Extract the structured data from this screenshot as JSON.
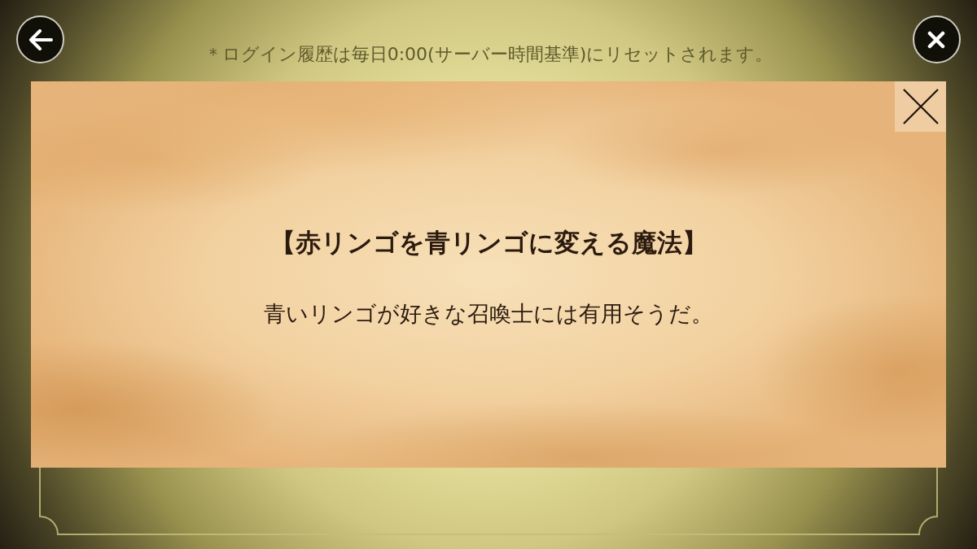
{
  "notice": "＊ログイン履歴は毎日0:00(サーバー時間基準)にリセットされます。",
  "dialog": {
    "title": "【赤リンゴを青リンゴに変える魔法】",
    "description": "青いリンゴが好きな召喚士には有用そうだ。"
  }
}
